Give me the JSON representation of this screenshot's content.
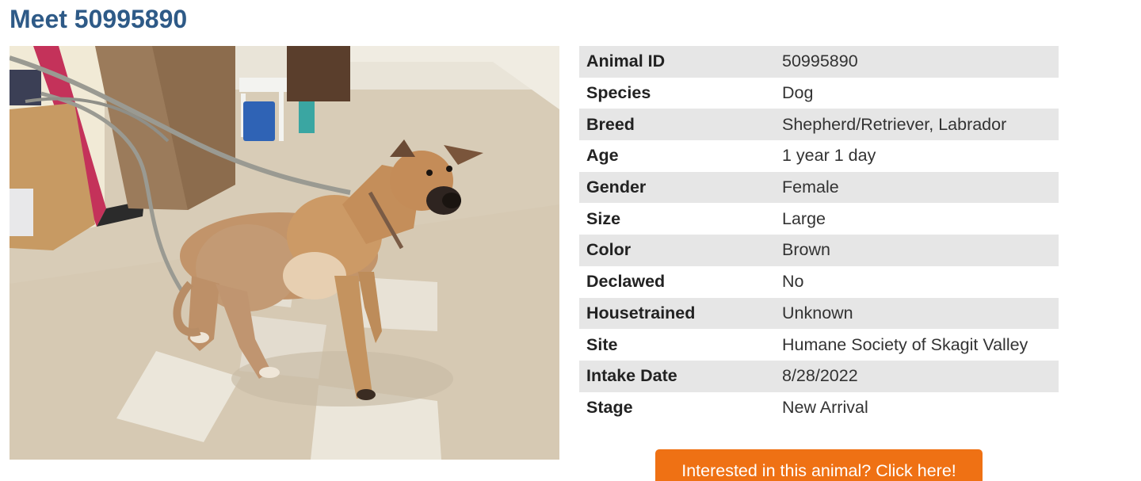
{
  "header": {
    "title": "Meet 50995890"
  },
  "photo": {
    "subject": "dog-photo"
  },
  "details": [
    {
      "label": "Animal ID",
      "value": "50995890"
    },
    {
      "label": "Species",
      "value": "Dog"
    },
    {
      "label": "Breed",
      "value": "Shepherd/Retriever, Labrador"
    },
    {
      "label": "Age",
      "value": "1 year 1 day"
    },
    {
      "label": "Gender",
      "value": "Female"
    },
    {
      "label": "Size",
      "value": "Large"
    },
    {
      "label": "Color",
      "value": "Brown"
    },
    {
      "label": "Declawed",
      "value": "No"
    },
    {
      "label": "Housetrained",
      "value": "Unknown"
    },
    {
      "label": "Site",
      "value": "Humane Society of Skagit Valley"
    },
    {
      "label": "Intake Date",
      "value": "8/28/2022"
    },
    {
      "label": "Stage",
      "value": "New Arrival"
    }
  ],
  "cta": {
    "label": "Interested in this animal? Click here!"
  },
  "colors": {
    "title": "#2e5a87",
    "row_stripe": "#e6e6e6",
    "cta_background": "#ef7114"
  }
}
